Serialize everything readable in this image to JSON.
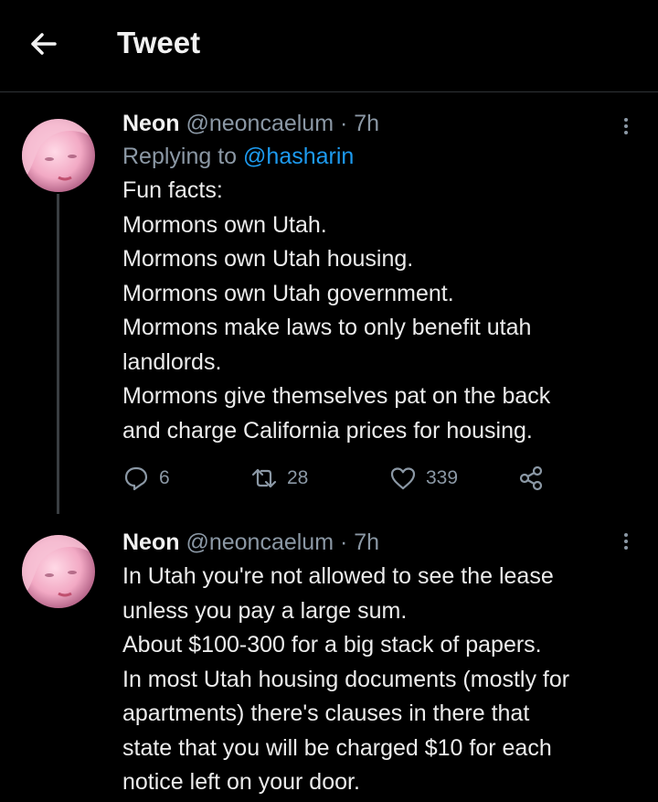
{
  "header": {
    "title": "Tweet"
  },
  "tweets": [
    {
      "name": "Neon",
      "handle": "@neoncaelum",
      "separator": "·",
      "time": "7h",
      "replying_prefix": "Replying to ",
      "replying_handle": "@hasharin",
      "lines": [
        "Fun facts:",
        "Mormons own Utah.",
        "Mormons own Utah housing.",
        "Mormons own Utah government.",
        "Mormons make laws to only benefit utah",
        "landlords.",
        "Mormons give themselves pat on the back",
        "and charge California prices for housing."
      ],
      "stats": {
        "replies": "6",
        "retweets": "28",
        "likes": "339"
      }
    },
    {
      "name": "Neon",
      "handle": "@neoncaelum",
      "separator": "·",
      "time": "7h",
      "lines": [
        "In Utah you're not allowed to see the lease",
        "unless you pay a large sum.",
        "About $100-300 for a big stack of papers.",
        "In most Utah housing documents (mostly for",
        "apartments) there's clauses in there that",
        "state that you will be charged $10 for each",
        "notice left on your door."
      ]
    }
  ],
  "colors": {
    "background": "#000000",
    "text": "#e7e9ea",
    "muted": "#8b98a5",
    "link": "#1d9bf0"
  },
  "icons": [
    "back-arrow-icon",
    "more-icon",
    "reply-icon",
    "retweet-icon",
    "like-icon",
    "share-icon"
  ]
}
